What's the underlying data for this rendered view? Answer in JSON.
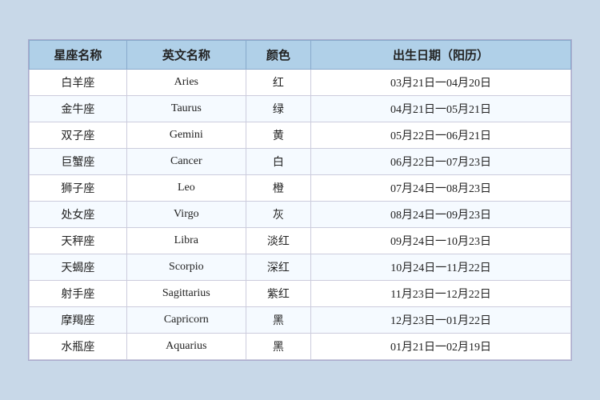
{
  "table": {
    "headers": [
      "星座名称",
      "英文名称",
      "颜色",
      "出生日期（阳历）"
    ],
    "rows": [
      {
        "zh": "白羊座",
        "en": "Aries",
        "color": "红",
        "date": "03月21日一04月20日"
      },
      {
        "zh": "金牛座",
        "en": "Taurus",
        "color": "绿",
        "date": "04月21日一05月21日"
      },
      {
        "zh": "双子座",
        "en": "Gemini",
        "color": "黄",
        "date": "05月22日一06月21日"
      },
      {
        "zh": "巨蟹座",
        "en": "Cancer",
        "color": "白",
        "date": "06月22日一07月23日"
      },
      {
        "zh": "狮子座",
        "en": "Leo",
        "color": "橙",
        "date": "07月24日一08月23日"
      },
      {
        "zh": "处女座",
        "en": "Virgo",
        "color": "灰",
        "date": "08月24日一09月23日"
      },
      {
        "zh": "天秤座",
        "en": "Libra",
        "color": "淡红",
        "date": "09月24日一10月23日"
      },
      {
        "zh": "天蝎座",
        "en": "Scorpio",
        "color": "深红",
        "date": "10月24日一11月22日"
      },
      {
        "zh": "射手座",
        "en": "Sagittarius",
        "color": "紫红",
        "date": "11月23日一12月22日"
      },
      {
        "zh": "摩羯座",
        "en": "Capricorn",
        "color": "黑",
        "date": "12月23日一01月22日"
      },
      {
        "zh": "水瓶座",
        "en": "Aquarius",
        "color": "黑",
        "date": "01月21日一02月19日"
      }
    ]
  }
}
